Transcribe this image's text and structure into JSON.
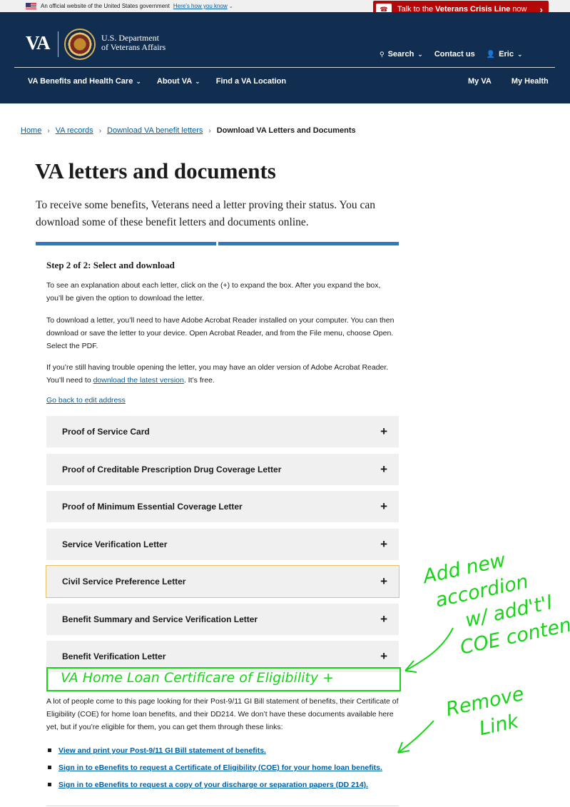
{
  "gov_banner": {
    "text": "An official website of the United States government",
    "link": "Here’s how you know"
  },
  "crisis": {
    "prefix": "Talk to the",
    "bold": "Veterans Crisis Line",
    "suffix": "now"
  },
  "header": {
    "logo": "VA",
    "dept_line1": "U.S. Department",
    "dept_line2": "of Veterans Affairs",
    "search": "Search",
    "contact": "Contact us",
    "user": "Eric"
  },
  "nav": {
    "benefits": "VA Benefits and Health Care",
    "about": "About VA",
    "find": "Find a VA Location",
    "myva": "My VA",
    "myhealth": "My Health"
  },
  "breadcrumb": [
    "Home",
    "VA records",
    "Download VA benefit letters",
    "Download VA Letters and Documents"
  ],
  "page": {
    "title": "VA letters and documents",
    "intro": "To receive some benefits, Veterans need a letter proving their status. You can download some of these benefit letters and documents online.",
    "progress": {
      "current_step": 2,
      "total_steps": 2
    },
    "step_title": "Step 2 of 2: Select and download",
    "p1": "To see an explanation about each letter, click on the (+) to expand the box. After you expand the box, you’ll be given the option to download the letter.",
    "p2": "To download a letter, you’ll need to have Adobe Acrobat Reader installed on your computer. You can then download or save the letter to your device. Open Acrobat Reader, and from the File menu, choose Open. Select the PDF.",
    "p3_before": "If you’re still having trouble opening the letter, you may have an older version of Adobe Acrobat Reader. You’ll need to ",
    "p3_link": "download the latest version",
    "p3_after": ". It’s free.",
    "back_link": "Go back to edit address"
  },
  "accordions": [
    "Proof of Service Card",
    "Proof of Creditable Prescription Drug Coverage Letter",
    "Proof of Minimum Essential Coverage Letter",
    "Service Verification Letter",
    "Civil Service Preference Letter",
    "Benefit Summary and Service Verification Letter",
    "Benefit Verification Letter"
  ],
  "annotations": {
    "box": "VA Home Loan Certificare of Eligibility +",
    "note1": [
      "Add new",
      "accordion",
      "w/ add't'l",
      "COE content"
    ],
    "note2": [
      "Remove",
      "Link"
    ]
  },
  "lower_text": "A lot of people come to this page looking for their Post-9/11 GI Bill statement of benefits, their Certificate of Eligibility (COE) for home loan benefits, and their DD214. We don’t have these documents available here yet, but if you’re eligible for them, you can get them through these links:",
  "links": [
    "View and print your Post-9/11 GI Bill statement of benefits.",
    "Sign in to eBenefits to request a Certificate of Eligibility (COE) for your home loan benefits.",
    "Sign in to eBenefits to request a copy of your discharge or separation papers (DD 214)."
  ],
  "colors": {
    "header": "#112e51",
    "crisis": "#b50909",
    "link": "#005ea2",
    "annotation": "#19d419",
    "progress": "#2e78c0"
  }
}
